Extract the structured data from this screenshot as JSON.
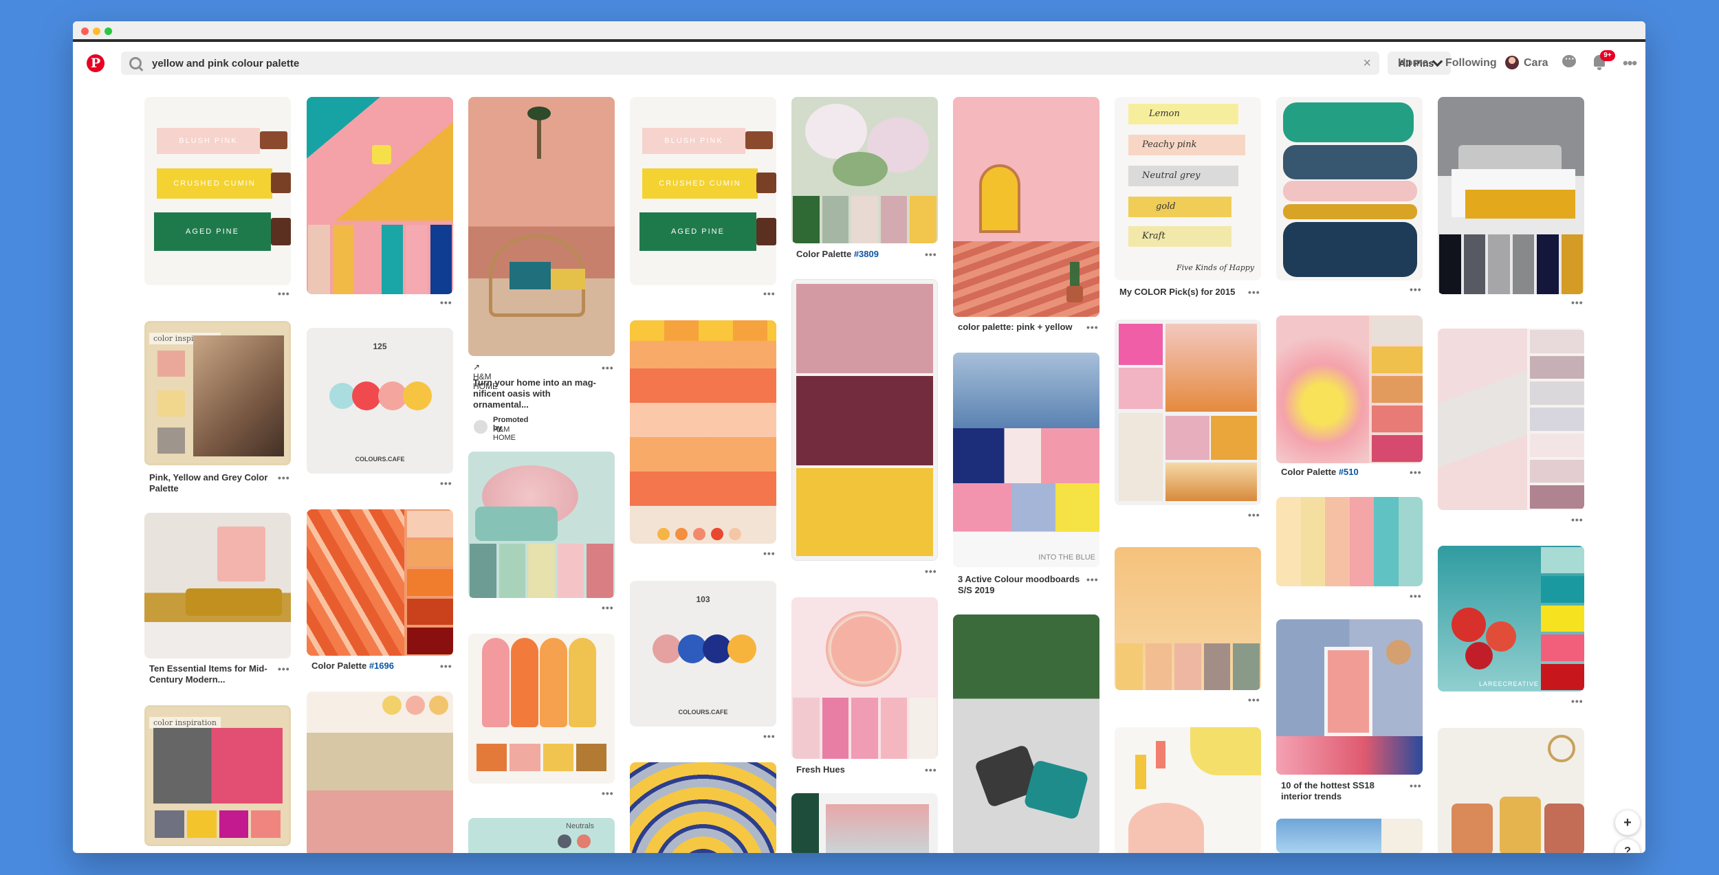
{
  "search": {
    "query": "yellow and pink colour palette",
    "filter": "All Pins"
  },
  "nav": {
    "home": "Home",
    "following": "Following",
    "user": "Cara",
    "badge": "9+"
  },
  "pins": {
    "c2_label": "125",
    "c2_brand": "COLOURS.CAFE",
    "c3_brand": "H&M HOME",
    "c3_title": "Turn your home into an mag-nificent oasis with ornamental...",
    "c3_promoted": "Promoted by",
    "c3_promoter": "H&M HOME",
    "c4_label": "103",
    "c4_brand": "COLOURS.CAFE",
    "palette_prefix": "Color Palette",
    "palette_1696": "#1696",
    "palette_3809": "#3809",
    "palette_510": "#510",
    "pink_yellow_grey": "Pink, Yellow and Grey Color Palette",
    "ten_items": "Ten Essential Items for Mid-Century Modern...",
    "fresh_hues": "Fresh Hues",
    "pink_yellow": "color palette: pink + yellow",
    "moodboards": "3 Active Colour moodboards S/S 2019",
    "my_pick": "My COLOR Pick(s) for 2015",
    "hottest": "10 of the hottest SS18 interior trends",
    "inspiration": "color inspiration",
    "paint1": "BLUSH PINK",
    "paint2": "CRUSHED CUMIN",
    "paint3": "AGED PINE",
    "neutrals": "Neutrals",
    "script": [
      "Lemon",
      "Peachy pink",
      "Neutral grey",
      "gold",
      "Kraft",
      "Five Kinds of Happy"
    ],
    "into_blue": "INTO THE BLUE",
    "creative": "LAREECREATIVE"
  }
}
